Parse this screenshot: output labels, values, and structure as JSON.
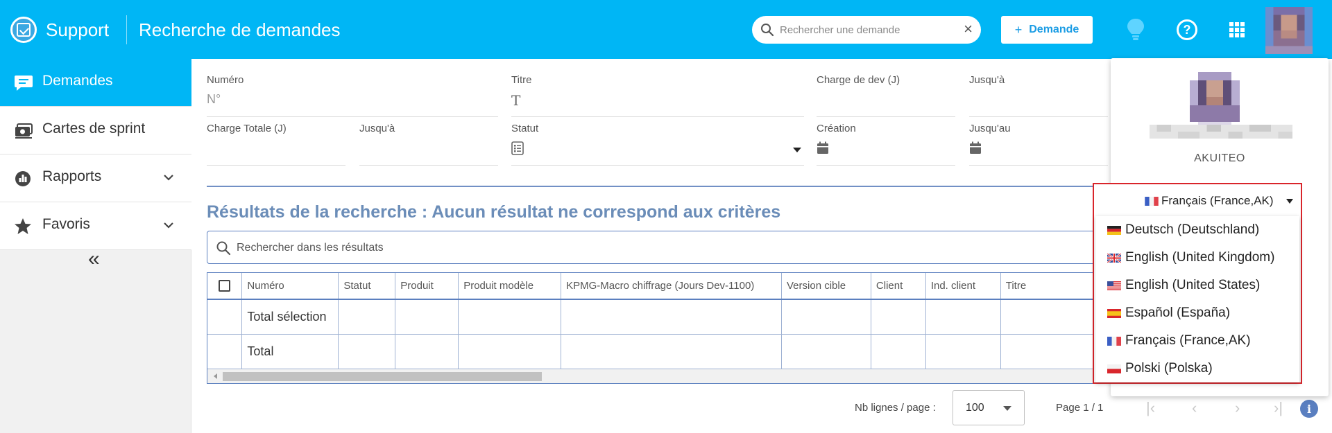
{
  "header": {
    "app_name": "Support",
    "page_title": "Recherche de demandes",
    "search_placeholder": "Rechercher une demande",
    "new_button_label": "Demande",
    "new_button_icon": "+"
  },
  "sidebar": {
    "items": [
      {
        "label": "Demandes",
        "icon": "chat-icon",
        "active": true
      },
      {
        "label": "Cartes de sprint",
        "icon": "cards-icon"
      },
      {
        "label": "Rapports",
        "icon": "chart-icon",
        "expandable": true
      },
      {
        "label": "Favoris",
        "icon": "star-icon",
        "expandable": true
      }
    ],
    "collapse_label": "«"
  },
  "filters": {
    "numero": {
      "label": "Numéro",
      "placeholder": "N°"
    },
    "titre": {
      "label": "Titre",
      "icon": "T"
    },
    "charge_dev": {
      "label": "Charge de dev (J)"
    },
    "charge_dev_to": {
      "label": "Jusqu'à"
    },
    "charge_totale": {
      "label": "Charge Totale (J)"
    },
    "charge_totale_to": {
      "label": "Jusqu'à"
    },
    "statut": {
      "label": "Statut"
    },
    "creation": {
      "label": "Création"
    },
    "creation_to": {
      "label": "Jusqu'au"
    }
  },
  "results": {
    "title": "Résultats de la recherche : Aucun résultat ne correspond aux critères",
    "search_placeholder": "Rechercher dans les résultats"
  },
  "table": {
    "columns": [
      "Numéro",
      "Statut",
      "Produit",
      "Produit modèle",
      "KPMG-Macro chiffrage (Jours Dev-1100)",
      "Version cible",
      "Client",
      "Ind. client",
      "Titre"
    ],
    "rows": [
      {
        "label": "Total sélection"
      },
      {
        "label": "Total"
      }
    ]
  },
  "pagination": {
    "rows_per_page_label": "Nb lignes / page :",
    "rows_per_page_value": "100",
    "page_info": "Page 1 / 1",
    "first": "|‹",
    "prev": "‹",
    "next": "›",
    "last": "›|",
    "info": "i"
  },
  "profile": {
    "company": "AKUITEO",
    "current_language": "Français (France,AK)",
    "languages": [
      {
        "label": "Deutsch (Deutschland)",
        "flag": "de"
      },
      {
        "label": "English (United Kingdom)",
        "flag": "gb"
      },
      {
        "label": "English (United States)",
        "flag": "us"
      },
      {
        "label": "Español (España)",
        "flag": "es"
      },
      {
        "label": "Français (France,AK)",
        "flag": "fr"
      },
      {
        "label": "Polski (Polska)",
        "flag": "pl"
      }
    ]
  },
  "colors": {
    "header": "#00b6f5",
    "accent": "#1a9ce4",
    "results_title": "#6b8db8",
    "highlight_border": "#d9252b"
  }
}
